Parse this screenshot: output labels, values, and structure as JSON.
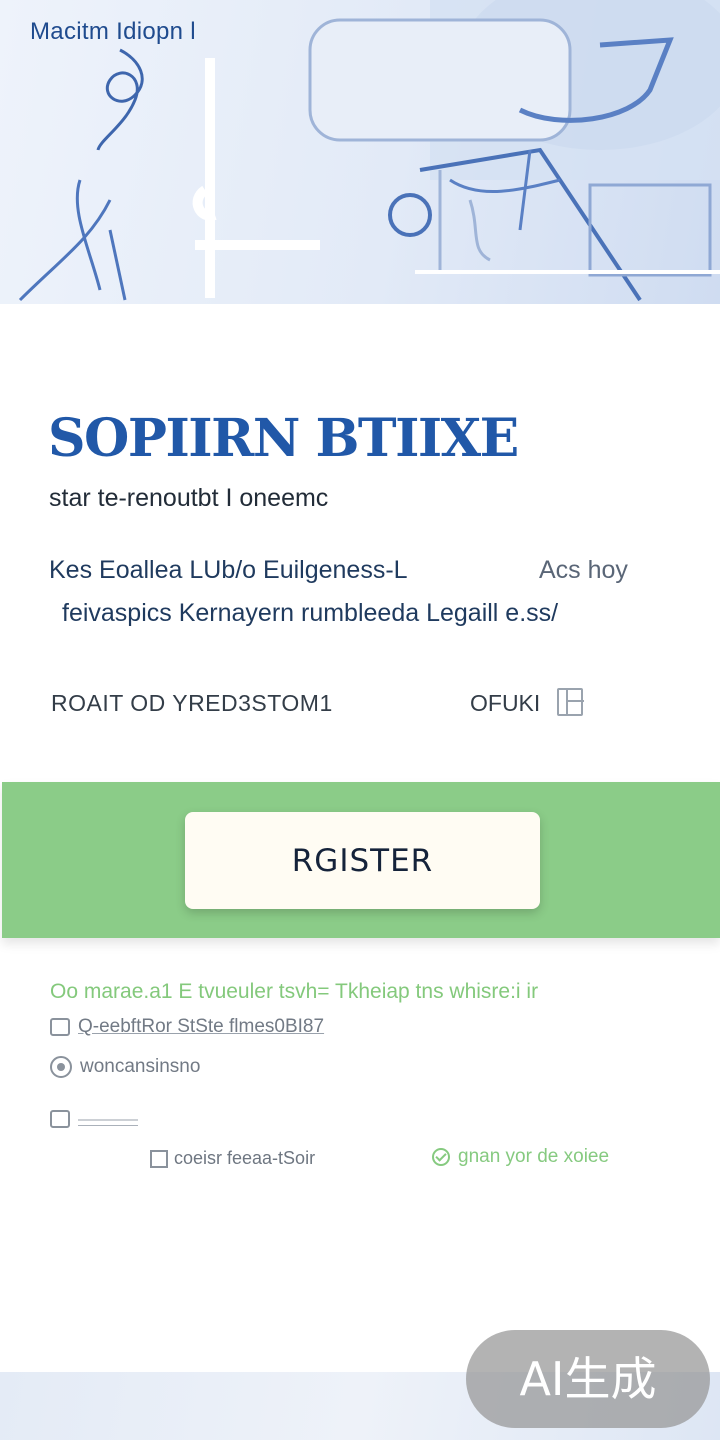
{
  "header": {
    "brand": "Macitm Idiopn l"
  },
  "hero_copy": {
    "headline": "SOPIIRN BTIIXE",
    "subtitle": "star te-renoutbt I oneemc",
    "description_line1": "Kes Eoallea LUb/o Euilgeness-L",
    "description_aside": "Acs hoy",
    "description_line2": "feivaspics Kernayern rumbleeda Legaill e.ss/"
  },
  "meta": {
    "left_label": "ROAIT OD YRED3STOM1",
    "right_label": "OFUKI",
    "right_icon": "calendar-icon"
  },
  "cta": {
    "register_label": "RGISTER",
    "band_color": "#8bcc88"
  },
  "details": {
    "notice": "Oo marae.a1 E tvueuler tsvh= Tkheiap tns whisre:i ir",
    "row1": "Q-eebftRor StSte flmes0BI87",
    "row2": "woncansinsno",
    "row3": "————"
  },
  "footer": {
    "left_label": "coeisr feeaa-tSoir",
    "right_label": "gnan yor de xoiee"
  },
  "watermark": {
    "text": "AI生成"
  },
  "colors": {
    "accent_blue": "#2158a8",
    "accent_green": "#84c97c"
  }
}
